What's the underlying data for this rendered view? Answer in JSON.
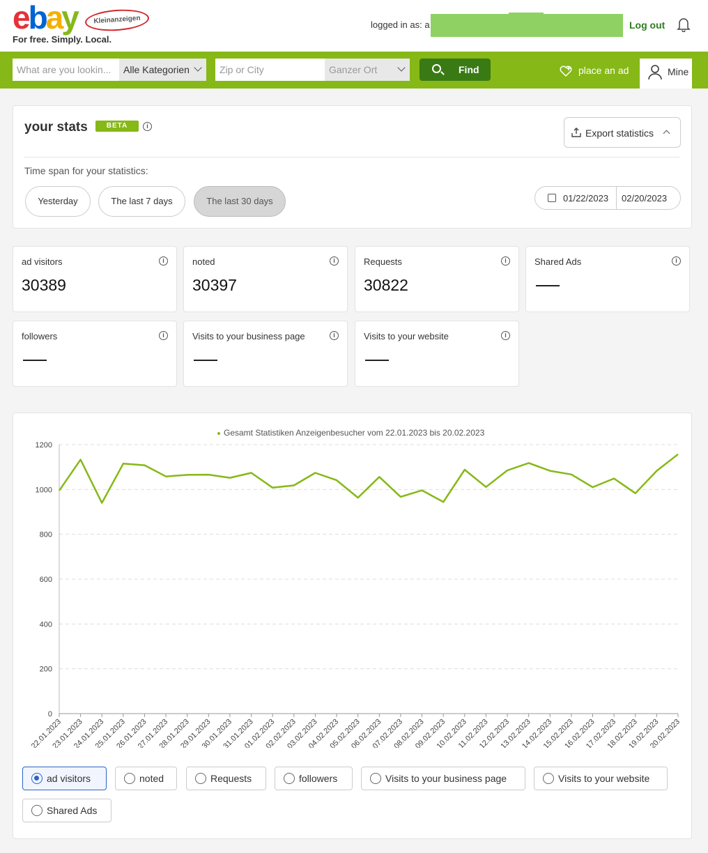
{
  "header": {
    "logo_text": "ebay",
    "logo_badge": "Kleinanzeigen",
    "tagline": "For free. Simply. Local.",
    "logged_in_label": "logged in as: a",
    "logout_label": "Log out"
  },
  "search": {
    "query_placeholder": "What are you lookin...",
    "category": "Alle Kategorien",
    "location_placeholder": "Zip or City",
    "radius": "Ganzer Ort",
    "find_label": "Find",
    "place_ad_label": "place an ad",
    "mine_label": "Mine"
  },
  "stats": {
    "title": "your stats",
    "badge": "BETA",
    "export_label": "Export statistics",
    "timespan_label": "Time span for your statistics:",
    "timespans": [
      "Yesterday",
      "The last 7 days",
      "The last 30 days"
    ],
    "active_timespan": "The last 30 days",
    "date_from": "01/22/2023",
    "date_to": "02/20/2023"
  },
  "stat_cards": [
    {
      "label": "ad visitors",
      "value": "30389"
    },
    {
      "label": "noted",
      "value": "30397"
    },
    {
      "label": "Requests",
      "value": "30822"
    },
    {
      "label": "Shared Ads",
      "value": "—"
    },
    {
      "label": "followers",
      "value": "—"
    },
    {
      "label": "Visits to your business page",
      "value": "—"
    },
    {
      "label": "Visits to your website",
      "value": "—"
    }
  ],
  "chart_data": {
    "type": "line",
    "legend": "Gesamt Statistiken Anzeigenbesucher vom 22.01.2023 bis 20.02.2023",
    "ylim": [
      0,
      1200
    ],
    "yticks": [
      0,
      200,
      400,
      600,
      800,
      1000,
      1200
    ],
    "grid": true,
    "color": "#86b817",
    "x": [
      "22.01.2023",
      "23.01.2023",
      "24.01.2023",
      "25.01.2023",
      "26.01.2023",
      "27.01.2023",
      "28.01.2023",
      "29.01.2023",
      "30.01.2023",
      "31.01.2023",
      "01.02.2023",
      "02.02.2023",
      "03.02.2023",
      "04.02.2023",
      "05.02.2023",
      "06.02.2023",
      "07.02.2023",
      "08.02.2023",
      "09.02.2023",
      "10.02.2023",
      "11.02.2023",
      "12.02.2023",
      "13.02.2023",
      "14.02.2023",
      "15.02.2023",
      "16.02.2023",
      "17.02.2023",
      "18.02.2023",
      "19.02.2023",
      "20.02.2023"
    ],
    "values": [
      995,
      1133,
      940,
      1115,
      1108,
      1058,
      1065,
      1066,
      1052,
      1074,
      1008,
      1018,
      1074,
      1041,
      963,
      1056,
      967,
      996,
      944,
      1088,
      1011,
      1085,
      1118,
      1083,
      1067,
      1010,
      1049,
      983,
      1083,
      1157
    ]
  },
  "chart_options": [
    "ad visitors",
    "noted",
    "Requests",
    "followers",
    "Visits to your business page",
    "Visits to your website",
    "Shared Ads"
  ],
  "selected_chart_option": "ad visitors"
}
